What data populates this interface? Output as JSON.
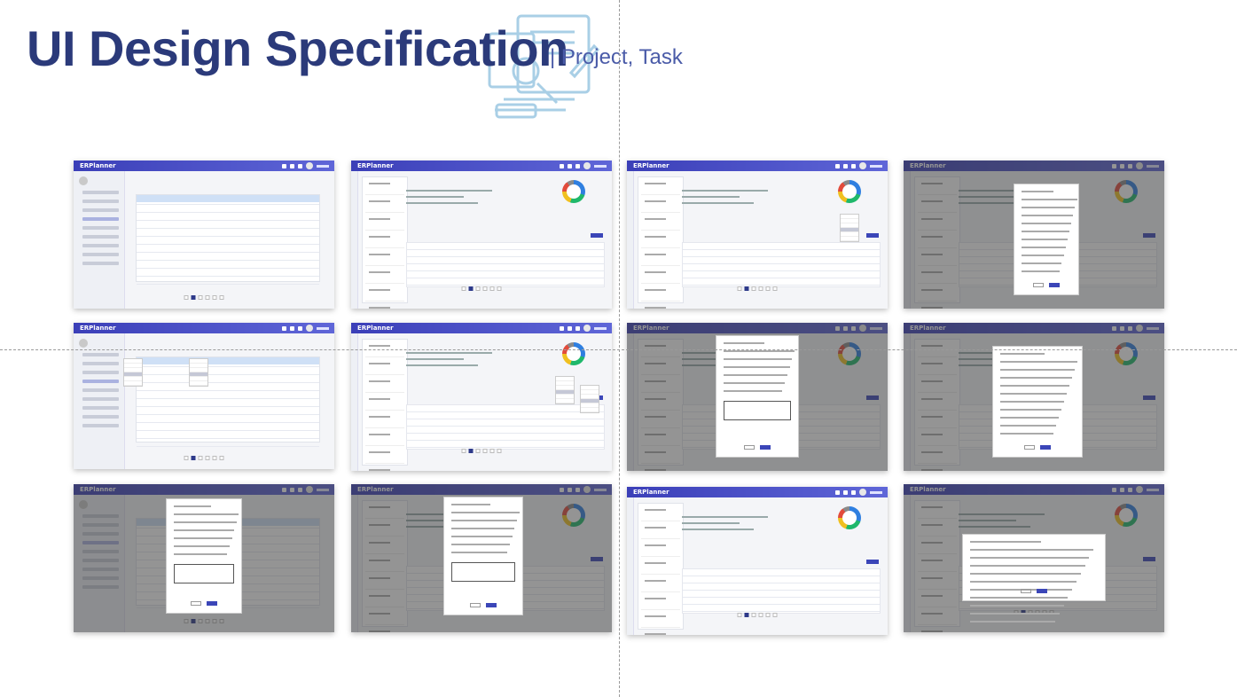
{
  "title": "UI Design Specification",
  "subtitle": "| Project, Task",
  "thumbnail_brand": "ERPlanner",
  "colors": {
    "title": "#2b3a7a",
    "subtitle": "#4a5ba8",
    "header_bar": "#3b3fb8"
  }
}
